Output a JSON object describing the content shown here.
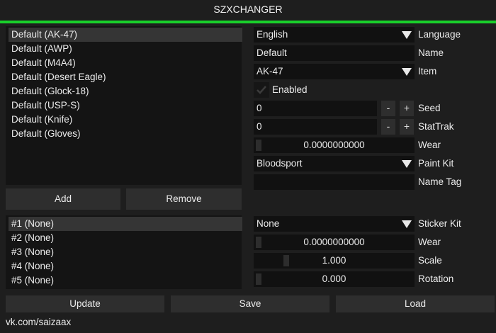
{
  "app": {
    "title": "SZXCHANGER",
    "accent_color": "#19d02b"
  },
  "weapons": {
    "items": [
      "Default (AK-47)",
      "Default (AWP)",
      "Default (M4A4)",
      "Default (Desert Eagle)",
      "Default (Glock-18)",
      "Default (USP-S)",
      "Default (Knife)",
      "Default (Gloves)"
    ],
    "selected_index": 0
  },
  "buttons": {
    "add": "Add",
    "remove": "Remove",
    "update": "Update",
    "save": "Save",
    "load": "Load"
  },
  "skin": {
    "language": {
      "value": "English",
      "label": "Language"
    },
    "name": {
      "value": "Default",
      "label": "Name"
    },
    "item": {
      "value": "AK-47",
      "label": "Item"
    },
    "enabled": {
      "label": "Enabled",
      "checked": true
    },
    "seed": {
      "value": "0",
      "label": "Seed",
      "minus": "-",
      "plus": "+"
    },
    "stattrak": {
      "value": "0",
      "label": "StatTrak",
      "minus": "-",
      "plus": "+"
    },
    "wear": {
      "value": "0.0000000000",
      "label": "Wear"
    },
    "paint_kit": {
      "value": "Bloodsport",
      "label": "Paint Kit"
    },
    "name_tag": {
      "value": "",
      "label": "Name Tag"
    }
  },
  "stickers": {
    "items": [
      "#1 (None)",
      "#2 (None)",
      "#3 (None)",
      "#4 (None)",
      "#5 (None)"
    ],
    "selected_index": 0
  },
  "sticker": {
    "kit": {
      "value": "None",
      "label": "Sticker Kit"
    },
    "wear": {
      "value": "0.0000000000",
      "label": "Wear"
    },
    "scale": {
      "value": "1.000",
      "label": "Scale"
    },
    "rotation": {
      "value": "0.000",
      "label": "Rotation"
    }
  },
  "footer": {
    "link": "vk.com/saizaax"
  }
}
